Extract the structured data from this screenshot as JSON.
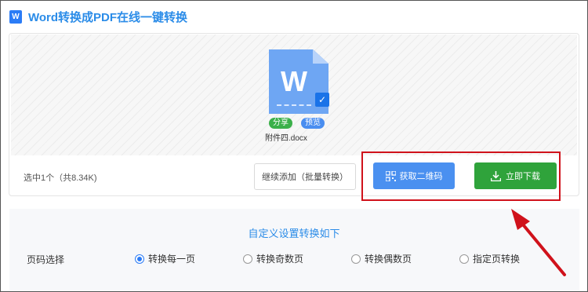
{
  "header": {
    "logo_letter": "W",
    "title": "Word转换成PDF在线一键转换"
  },
  "file": {
    "icon_letter": "W",
    "name": "附件四.docx",
    "share_tag": "分享",
    "preview_tag": "预览"
  },
  "toolbar": {
    "selected_info": "选中1个（共8.34K)",
    "add_more_label": "继续添加（批量转换）",
    "qr_label": "获取二维码",
    "download_label": "立即下载"
  },
  "options": {
    "title": "自定义设置转换如下",
    "page_label": "页码选择",
    "choices": [
      {
        "label": "转换每一页",
        "selected": true
      },
      {
        "label": "转换奇数页",
        "selected": false
      },
      {
        "label": "转换偶数页",
        "selected": false
      },
      {
        "label": "指定页转换",
        "selected": false
      }
    ]
  },
  "colors": {
    "accent": "#2b8ce8",
    "qr_button": "#4a90f0",
    "download_button": "#2fa33b",
    "annotation": "#d0121b"
  },
  "icons": {
    "qr": "qr-code-icon",
    "download": "download-icon",
    "check": "check-icon"
  }
}
